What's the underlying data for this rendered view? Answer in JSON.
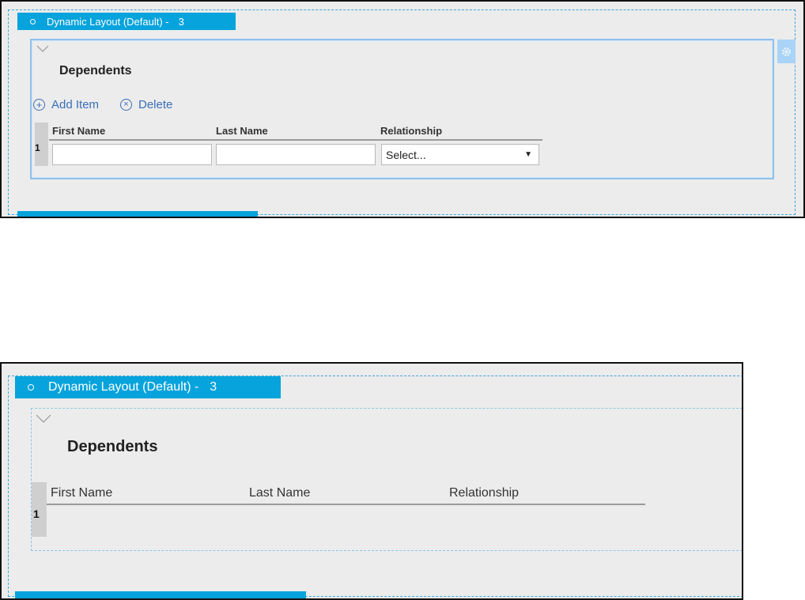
{
  "top": {
    "tab": {
      "label": "Dynamic Layout (Default) -",
      "count": "3"
    },
    "section": {
      "title": "Dependents",
      "add_label": "Add Item",
      "delete_label": "Delete",
      "columns": [
        "First Name",
        "Last Name",
        "Relationship"
      ],
      "row_number": "1",
      "first_name_value": "",
      "last_name_value": "",
      "relationship_value": "Select..."
    }
  },
  "bottom": {
    "tab": {
      "label": "Dynamic Layout (Default) -",
      "count": "3"
    },
    "section": {
      "title": "Dependents",
      "columns": [
        "First Name",
        "Last Name",
        "Relationship"
      ],
      "row_number": "1"
    }
  },
  "colors": {
    "tab_blue": "#06a3dc",
    "link_blue": "#3a6fb7",
    "panel_gray": "#ececec"
  },
  "icons": [
    "circle-bullet-icon",
    "chevron-down-icon",
    "add-circle-icon",
    "delete-circle-icon",
    "dropdown-arrow-icon",
    "gear-icon"
  ]
}
